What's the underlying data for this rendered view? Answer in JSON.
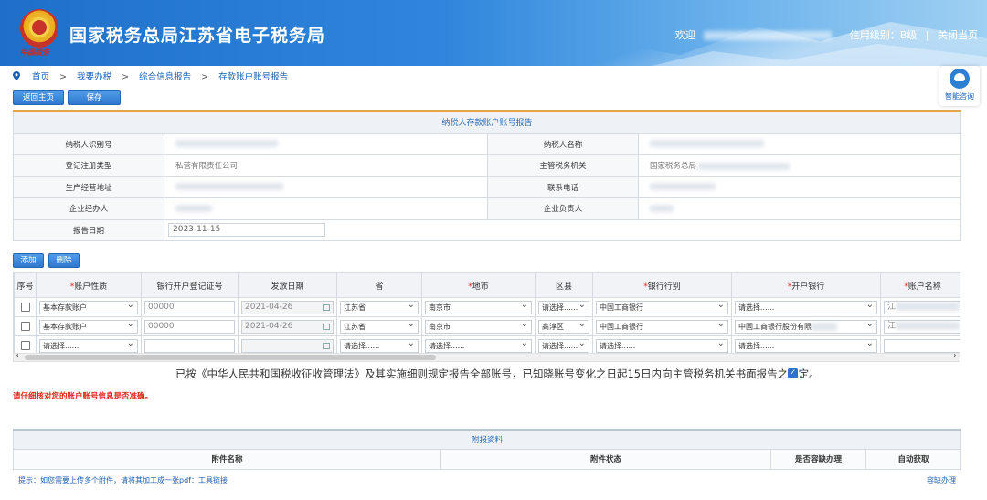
{
  "header": {
    "site_title": "国家税务总局江苏省电子税务局",
    "emblem_caption": "中国税务",
    "welcome": "欢迎",
    "credit_level": "信用级别：B级",
    "close_page": "关闭当页",
    "separator": "|"
  },
  "breadcrumb": {
    "items": [
      "首页",
      "我要办税",
      "综合信息报告",
      "存款账户账号报告"
    ],
    "separator": ">"
  },
  "help": {
    "label": "智能咨询"
  },
  "toolbar": {
    "back_label": "返回主页",
    "save_label": "保存"
  },
  "info": {
    "caption": "纳税人存款账户账号报告",
    "rows": [
      {
        "l1": "纳税人识别号",
        "v1": "",
        "l2": "纳税人名称",
        "v2": ""
      },
      {
        "l1": "登记注册类型",
        "v1": "私营有限责任公司",
        "l2": "主管税务机关",
        "v2": "国家税务总局"
      },
      {
        "l1": "生产经营地址",
        "v1": "",
        "l2": "联系电话",
        "v2": ""
      },
      {
        "l1": "企业经办人",
        "v1": "",
        "l2": "企业负责人",
        "v2": ""
      }
    ],
    "report_date_label": "报告日期",
    "report_date": "2023-11-15"
  },
  "table_actions": {
    "add_label": "添加",
    "delete_label": "删除"
  },
  "accounts": {
    "headers": [
      "序号",
      "账户性质",
      "银行开户登记证号",
      "发放日期",
      "省",
      "地市",
      "区县",
      "银行行别",
      "开户银行",
      "账户名称"
    ],
    "required_mark": "*",
    "rows": [
      {
        "nature": "基本存款账户",
        "cert": "00000",
        "date": "2021-04-26",
        "province": "江苏省",
        "city": "南京市",
        "district": "请选择......",
        "bank_type": "中国工商银行",
        "bank": "请选择......",
        "account_name": "江"
      },
      {
        "nature": "基本存款账户",
        "cert": "00000",
        "date": "2021-04-26",
        "province": "江苏省",
        "city": "南京市",
        "district": "高淳区",
        "bank_type": "中国工商银行",
        "bank": "中国工商银行股份有限",
        "account_name": "江"
      },
      {
        "nature": "请选择......",
        "cert": "",
        "date": "",
        "province": "请选择......",
        "city": "请选择......",
        "district": "请选择......",
        "bank_type": "请选择......",
        "bank": "请选择......",
        "account_name": ""
      }
    ]
  },
  "scroll": {
    "left_arrow": "‹",
    "right_arrow": "›"
  },
  "declaration": "已按《中华人民共和国税收征收管理法》及其实施细则规定报告全部账号，已知晓账号变化之日起15日内向主管税务机关书面报告之规定。",
  "declaration_checked": true,
  "warning": "请仔细核对您的账户账号信息是否准确。",
  "attachments": {
    "caption": "附报资料",
    "headers": [
      "附件名称",
      "附件状态",
      "是否容缺办理",
      "自动获取"
    ]
  },
  "tip": "提示：如您需要上传多个附件，请将其加工成一张pdf：工具链接",
  "tip_right": "容缺办理",
  "colors": {
    "brand_blue": "#2f77cf",
    "required_red": "#e0261b",
    "accent_orange": "#e3a64b"
  }
}
